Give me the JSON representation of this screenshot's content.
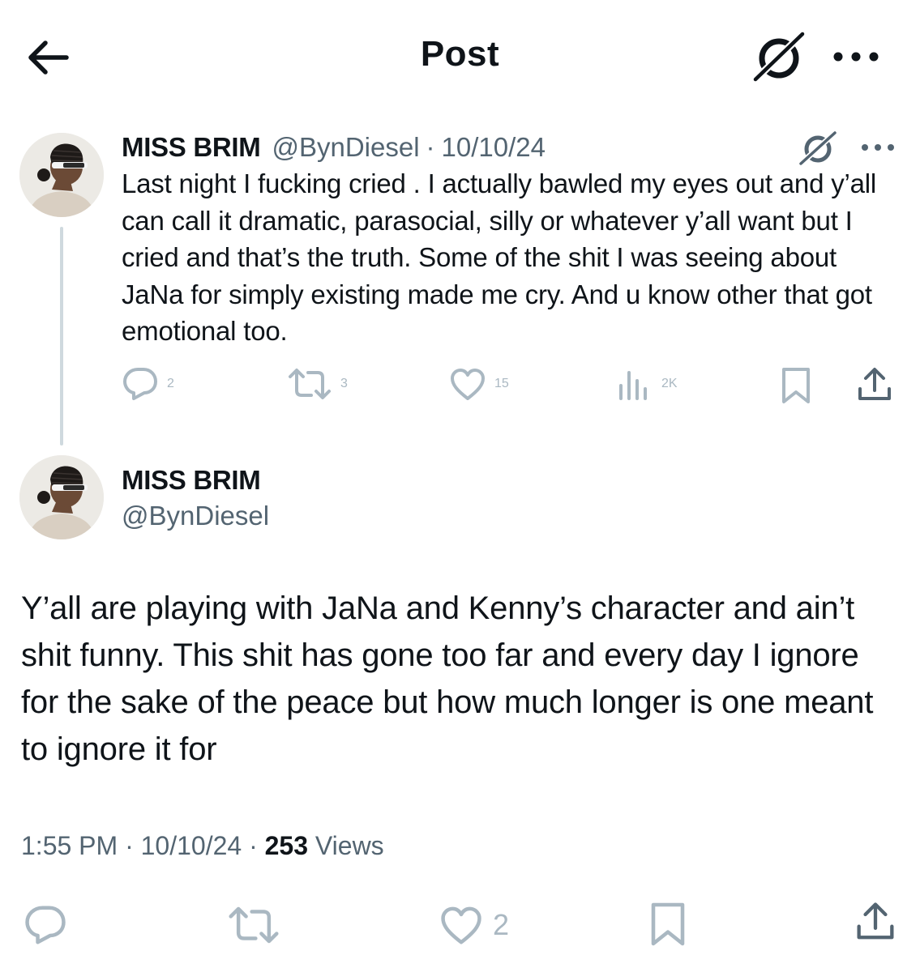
{
  "header": {
    "title": "Post",
    "back_icon": "arrow-left-icon",
    "grok_icon": "grok-icon",
    "more_icon": "more-horizontal-icon"
  },
  "parent_post": {
    "display_name": "MISS BRIM",
    "handle": "@BynDiesel",
    "separator": "·",
    "date": "10/10/24",
    "text": "Last night I fucking cried . I actually bawled my eyes out and y’all can call it dramatic, parasocial, silly or whatever y’all want but I cried and that’s the truth. Some of the shit I was seeing about JaNa for simply existing made me cry. And u know other that got emotional too.",
    "replies": "2",
    "reposts": "3",
    "likes": "15",
    "views": "2K"
  },
  "main_post": {
    "display_name": "MISS BRIM",
    "handle": "@BynDiesel",
    "text": "Y’all are playing with JaNa and Kenny’s character and ain’t shit funny. This shit has gone too far and every day I ignore for the sake of the peace but how much longer is one meant to ignore it for",
    "time": "1:55 PM",
    "separator": "·",
    "date": "10/10/24",
    "views_count": "253",
    "views_label": "Views",
    "likes": "2"
  },
  "colors": {
    "text_primary": "#0f1419",
    "text_secondary": "#536471",
    "icon_muted": "#aab8c2",
    "thread_line": "#cfd9de",
    "background": "#ffffff"
  }
}
